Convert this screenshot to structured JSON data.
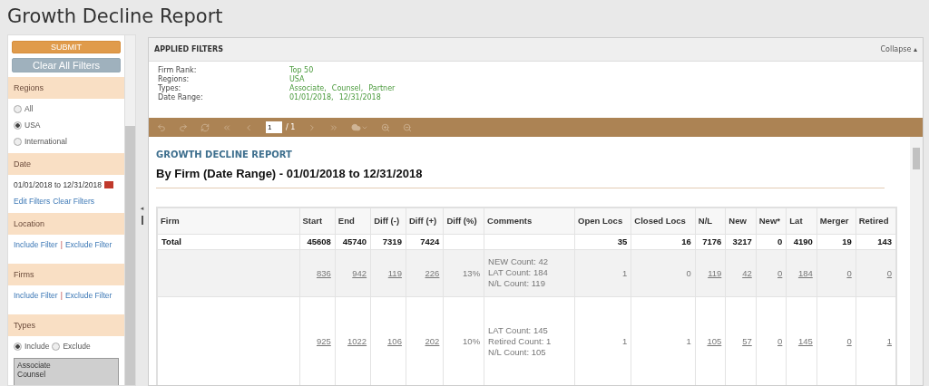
{
  "page_title": "Growth Decline Report",
  "splitter_arrow": "◂",
  "sidebar": {
    "submit": "SUBMIT",
    "clear": "Clear All Filters",
    "sections": [
      {
        "kind": "radios",
        "title": "Regions",
        "options": [
          {
            "label": "All",
            "selected": false
          },
          {
            "label": "USA",
            "selected": true
          },
          {
            "label": "International",
            "selected": false
          }
        ]
      },
      {
        "kind": "date",
        "title": "Date",
        "from": "01/01/2018",
        "joiner": "to",
        "to": "12/31/2018",
        "links": [
          "Edit Filters",
          "Clear Filters"
        ]
      },
      {
        "kind": "links",
        "title": "Location",
        "links": [
          "Include Filter",
          "Exclude Filter"
        ],
        "separator": "|"
      },
      {
        "kind": "links",
        "title": "Firms",
        "links": [
          "Include Filter",
          "Exclude Filter"
        ],
        "separator": "|"
      },
      {
        "kind": "types",
        "title": "Types",
        "options": [
          {
            "label": "Include",
            "selected": true
          },
          {
            "label": "Exclude",
            "selected": false
          }
        ],
        "list": [
          "Associate",
          "Counsel"
        ]
      }
    ]
  },
  "applied_filters": {
    "title": "APPLIED FILTERS",
    "collapse": "Collapse",
    "collapse_icon": "▴",
    "items": [
      {
        "label": "Firm Rank:",
        "values": [
          "Top 50"
        ]
      },
      {
        "label": "Regions:",
        "values": [
          "USA"
        ]
      },
      {
        "label": "Types:",
        "values": [
          "Associate,",
          "Counsel,",
          "Partner"
        ]
      },
      {
        "label": "Date Range:",
        "values": [
          "01/01/2018,",
          "12/31/2018"
        ]
      }
    ]
  },
  "toolbar": {
    "page": "1",
    "total": "/ 1"
  },
  "report": {
    "title": "GROWTH DECLINE REPORT",
    "subtitle": "By Firm (Date Range) - 01/01/2018 to 12/31/2018",
    "columns": [
      "Firm",
      "Start",
      "End",
      "Diff (-)",
      "Diff (+)",
      "Diff (%)",
      "Comments",
      "Open Locs",
      "Closed Locs",
      "N/L",
      "New",
      "New*",
      "Lat",
      "Merger",
      "Retired"
    ],
    "total": {
      "firm": "Total",
      "start": "45608",
      "end": "45740",
      "diff_minus": "7319",
      "diff_plus": "7424",
      "open_locs": "35",
      "closed_locs": "16",
      "nl": "7176",
      "new": "3217",
      "new_star": "0",
      "lat": "4190",
      "merger": "19",
      "retired": "143"
    },
    "rows": [
      {
        "cells": [
          "",
          "836",
          "942",
          "119",
          "226",
          "13%",
          "NEW Count: 42\nLAT Count: 184\nN/L Count: 119",
          "1",
          "0",
          "119",
          "42",
          "0",
          "184",
          "0",
          "0"
        ]
      },
      {
        "cells": [
          "",
          "925",
          "1022",
          "106",
          "202",
          "10%",
          "LAT Count: 145\nRetired Count: 1\nN/L Count: 105",
          "1",
          "1",
          "105",
          "57",
          "0",
          "145",
          "0",
          "1"
        ]
      }
    ]
  }
}
